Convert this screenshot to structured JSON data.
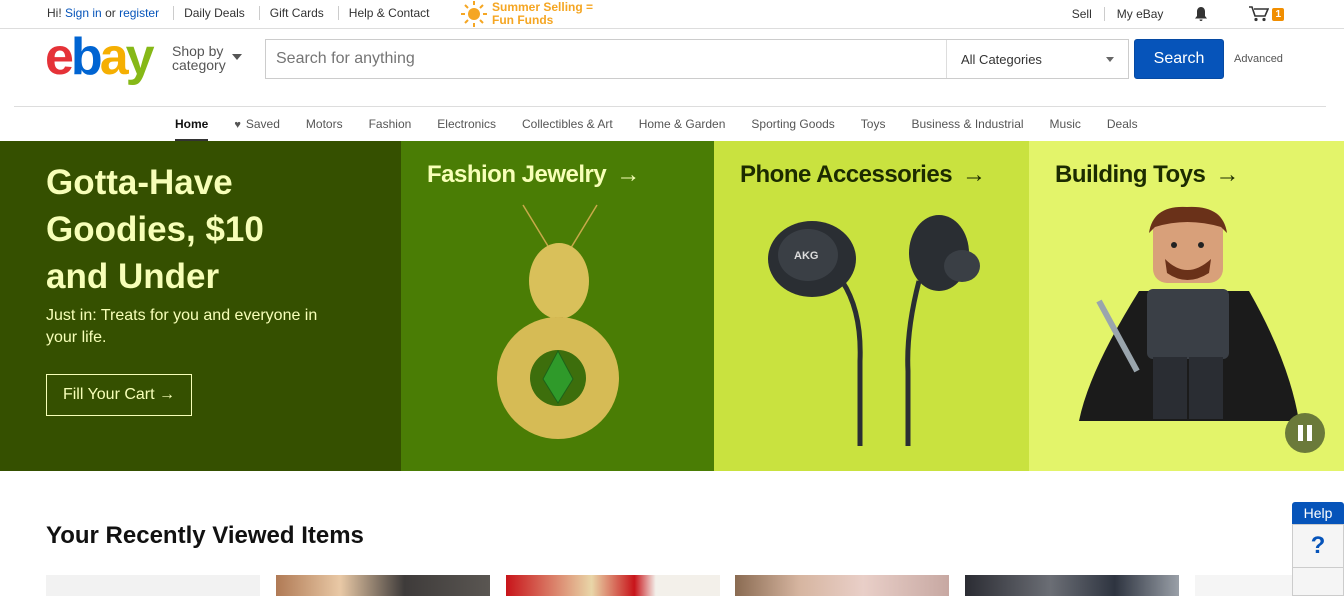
{
  "topbar": {
    "greeting": "Hi!",
    "sign_in": "Sign in",
    "or": "or",
    "register": "register",
    "links": [
      "Daily Deals",
      "Gift Cards",
      "Help & Contact"
    ],
    "promo_line1": "Summer Selling =",
    "promo_line2": "Fun Funds",
    "sell": "Sell",
    "my_ebay": "My eBay",
    "cart_count": "1"
  },
  "header": {
    "logo": [
      "e",
      "b",
      "a",
      "y"
    ],
    "shop_by": "Shop by",
    "category": "category",
    "search_placeholder": "Search for anything",
    "category_select": "All Categories",
    "search_button": "Search",
    "advanced": "Advanced"
  },
  "nav": {
    "items": [
      "Home",
      "Saved",
      "Motors",
      "Fashion",
      "Electronics",
      "Collectibles & Art",
      "Home & Garden",
      "Sporting Goods",
      "Toys",
      "Business & Industrial",
      "Music",
      "Deals"
    ]
  },
  "hero": {
    "title_line1": "Gotta-Have",
    "title_line2": "Goodies, $10",
    "title_line3": "and Under",
    "subtitle": "Just in: Treats for you and everyone in your life.",
    "cta": "Fill Your Cart →",
    "panels": [
      {
        "title": "Fashion Jewelry",
        "color": "#4a7d05"
      },
      {
        "title": "Phone Accessories",
        "color": "#c9e23f"
      },
      {
        "title": "Building Toys",
        "color": "#e3f46a"
      }
    ],
    "product_label": "AKG"
  },
  "recent": {
    "title": "Your Recently Viewed Items"
  },
  "help": {
    "label": "Help",
    "icon": "?"
  },
  "colors": {
    "ebay_blue": "#0654ba",
    "lead_bg": "#355000",
    "promo_orange": "#f5a623"
  }
}
